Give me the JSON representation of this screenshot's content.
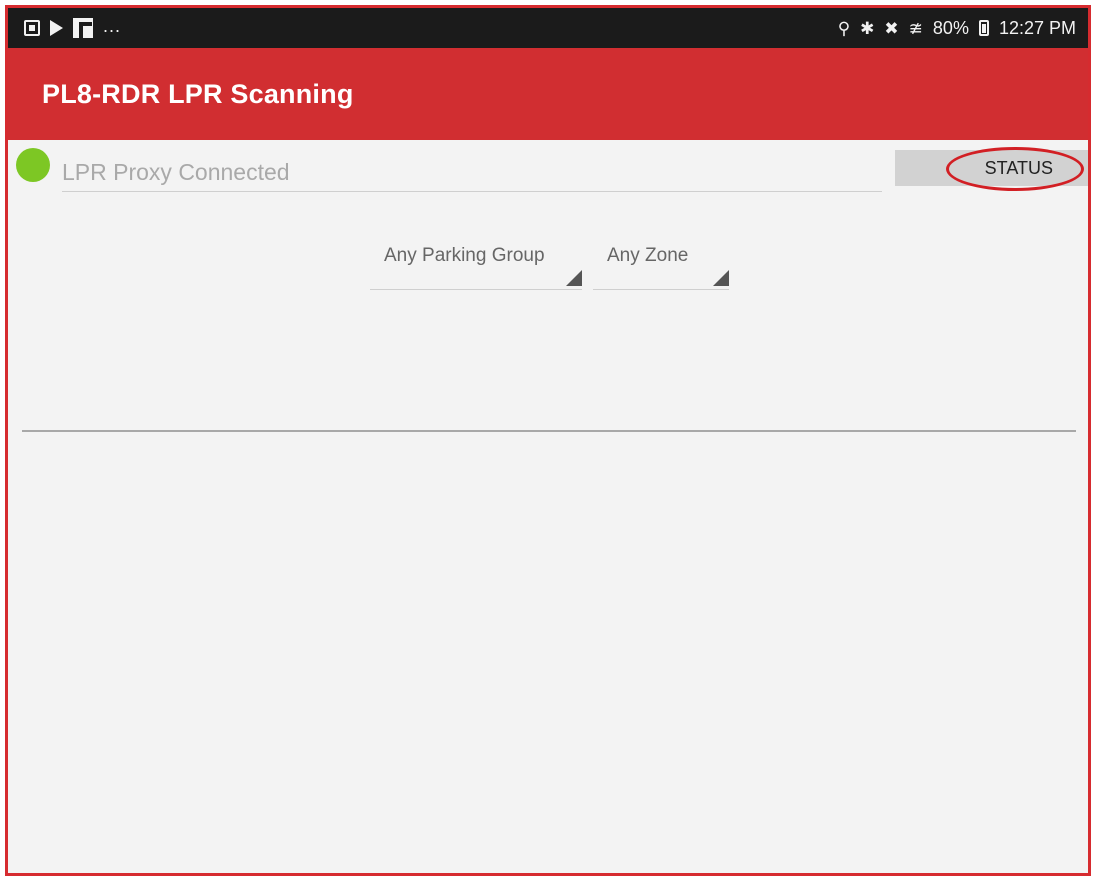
{
  "status_bar": {
    "left_icons": [
      "photo-icon",
      "play-store-icon",
      "flipboard-icon"
    ],
    "overflow": "...",
    "right_icons": [
      "location-icon",
      "bluetooth-icon",
      "mute-icon",
      "wifi-icon",
      "battery-icon"
    ],
    "battery": "80%",
    "time": "12:27 PM"
  },
  "app_bar": {
    "title": "PL8-RDR LPR Scanning",
    "color": "#d12e31"
  },
  "connection": {
    "indicator_color": "#7dc724",
    "text": "LPR Proxy Connected"
  },
  "status_button": {
    "label": "STATUS",
    "highlight_color": "#d21f24"
  },
  "filters": {
    "parking_group": {
      "selected": "Any Parking Group"
    },
    "zone": {
      "selected": "Any Zone"
    }
  }
}
